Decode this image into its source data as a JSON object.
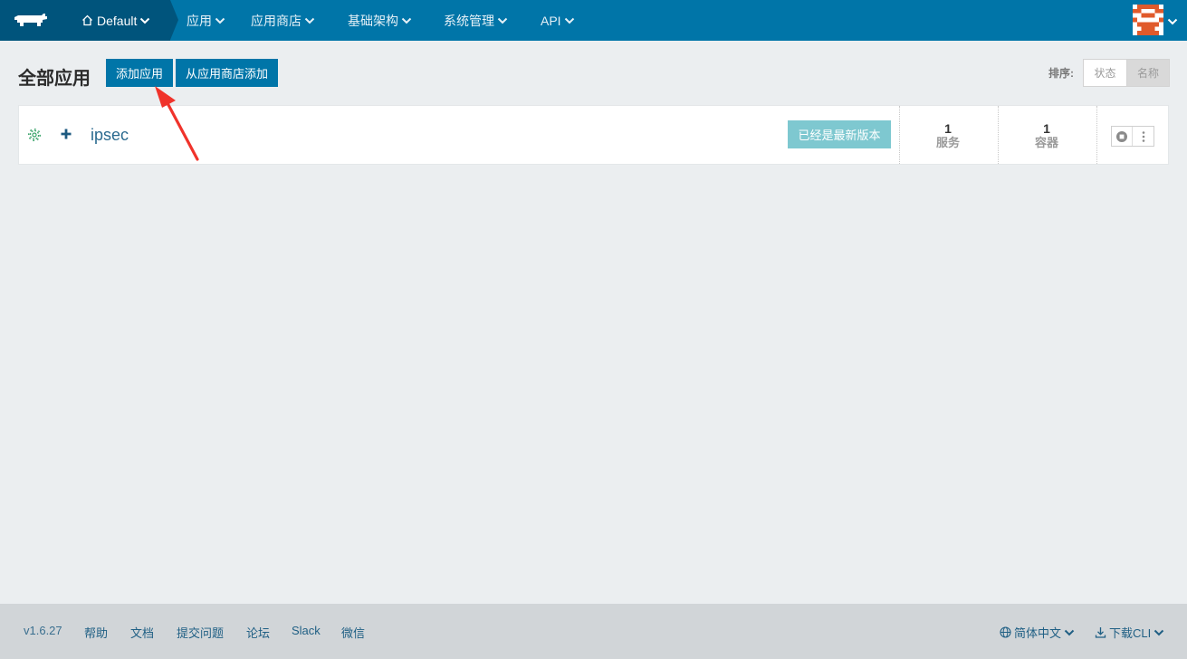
{
  "nav": {
    "environment": "Default",
    "items": [
      {
        "label": "应用"
      },
      {
        "label": "应用商店"
      },
      {
        "label": "基础架构"
      },
      {
        "label": "系统管理"
      },
      {
        "label": "API"
      }
    ]
  },
  "header": {
    "title": "全部应用",
    "add_button": "添加应用",
    "catalog_button": "从应用商店添加",
    "sort_label": "排序:",
    "sort_options": [
      "状态",
      "名称"
    ],
    "sort_selected": "名称"
  },
  "stacks": [
    {
      "name": "ipsec",
      "upgrade_status": "已经是最新版本",
      "services_count": "1",
      "services_label": "服务",
      "containers_count": "1",
      "containers_label": "容器"
    }
  ],
  "footer": {
    "version": "v1.6.27",
    "links": [
      "帮助",
      "文档",
      "提交问题",
      "论坛",
      "Slack",
      "微信"
    ],
    "language": "简体中文",
    "download": "下载CLI"
  },
  "colors": {
    "nav_bg": "#0075a8",
    "nav_dark": "#00547c",
    "badge": "#7ec8d0",
    "avatar": "#e05a2b",
    "annotation_arrow": "#f0332b"
  }
}
